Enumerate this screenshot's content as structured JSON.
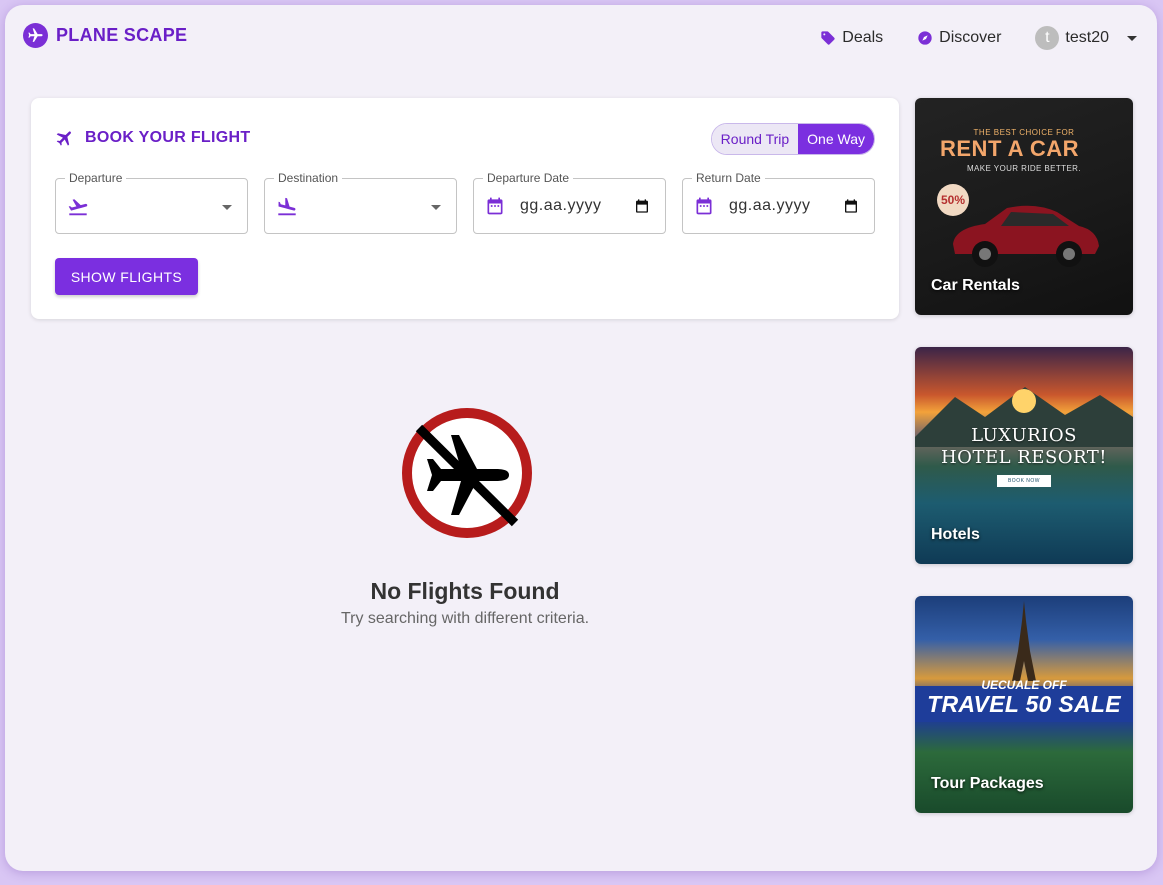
{
  "header": {
    "brand": "PLANE SCAPE",
    "nav": {
      "deals": "Deals",
      "discover": "Discover",
      "user_initial": "t",
      "user_name": "test20"
    }
  },
  "booking": {
    "title": "BOOK YOUR FLIGHT",
    "trip_type": {
      "round_trip": "Round Trip",
      "one_way": "One Way",
      "selected": "One Way"
    },
    "fields": {
      "departure_label": "Departure",
      "destination_label": "Destination",
      "departure_date_label": "Departure Date",
      "departure_date_placeholder": "gg.aa.yyyy",
      "return_date_label": "Return Date",
      "return_date_placeholder": "gg.aa.yyyy"
    },
    "search_button": "SHOW FLIGHTS"
  },
  "results": {
    "empty_title": "No Flights Found",
    "empty_subtitle": "Try searching with different criteria."
  },
  "promos": {
    "car": {
      "label": "Car Rentals",
      "kicker": "THE BEST CHOICE FOR",
      "headline": "RENT A CAR",
      "tagline": "MAKE YOUR RIDE BETTER.",
      "discount": "50%"
    },
    "hotel": {
      "label": "Hotels",
      "line1": "LUXURIOS",
      "line2": "HOTEL RESORT!",
      "cta": "BOOK NOW"
    },
    "tour": {
      "label": "Tour Packages",
      "line1": "UECUALE OFF",
      "line2": "TRAVEL 50 SALE"
    }
  },
  "colors": {
    "accent": "#7b2fe0",
    "brand_text": "#6a1fc7",
    "page_bg": "#f3f0f8",
    "outer_bg": "#d9c6f4",
    "no_flight_ring": "#b71c1c"
  }
}
